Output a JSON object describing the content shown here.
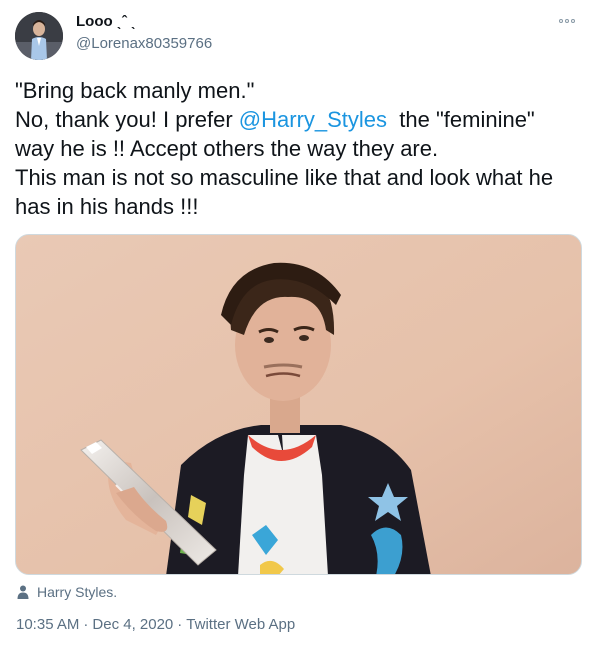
{
  "author": {
    "display_name": "Looo ˎˆ ˎ",
    "handle": "@Lorenax80359766",
    "avatar_icon": "profile-photo"
  },
  "more_icon": "more-options-icon",
  "tweet": {
    "line1": "\"Bring back manly men.\"",
    "line2_before": "No, thank you! I prefer ",
    "mention": "@Harry_Styles",
    "line2_after": "  the \"feminine\"",
    "line3": "way he is !! Accept others the way they are.",
    "line4": "This man is not so masculine like that and look what he",
    "line5": "has in his hands !!!"
  },
  "media": {
    "icon": "photo-man-holding-glass-bottle"
  },
  "tagged": {
    "icon": "person-icon",
    "label": "Harry Styles."
  },
  "metadata": {
    "time": "10:35 AM",
    "separator": "·",
    "date": "Dec 4, 2020",
    "source": "Twitter Web App"
  },
  "colors": {
    "link": "#1b95e0",
    "secondary_text": "#5b7083",
    "primary_text": "#0f1419"
  }
}
